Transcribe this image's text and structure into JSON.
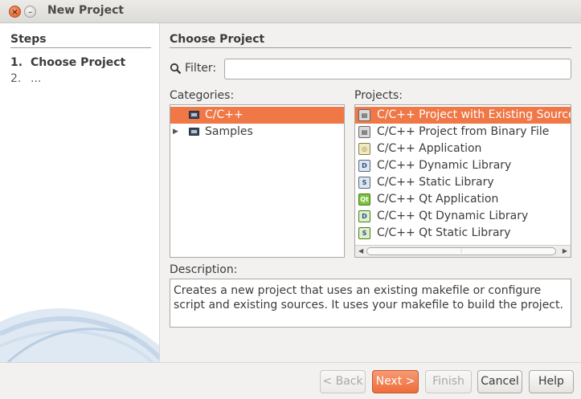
{
  "window": {
    "title": "New Project"
  },
  "steps": {
    "header": "Steps",
    "items": [
      {
        "num": "1.",
        "label": "Choose Project"
      },
      {
        "num": "2.",
        "label": "..."
      }
    ]
  },
  "main": {
    "header": "Choose Project",
    "filter_label": "Filter:",
    "filter_value": "",
    "categories_label": "Categories:",
    "projects_label": "Projects:",
    "description_label": "Description:"
  },
  "categories": [
    {
      "label": "C/C++",
      "selected": true,
      "expandable": false
    },
    {
      "label": "Samples",
      "selected": false,
      "expandable": true
    }
  ],
  "projects": [
    {
      "label": "C/C++ Project with Existing Sources",
      "icon": "project-existing-sources-icon",
      "selected": true
    },
    {
      "label": "C/C++ Project from Binary File",
      "icon": "project-binary-file-icon",
      "selected": false
    },
    {
      "label": "C/C++ Application",
      "icon": "application-icon",
      "selected": false
    },
    {
      "label": "C/C++ Dynamic Library",
      "icon": "dynamic-library-icon",
      "selected": false
    },
    {
      "label": "C/C++ Static Library",
      "icon": "static-library-icon",
      "selected": false
    },
    {
      "label": "C/C++ Qt Application",
      "icon": "qt-application-icon",
      "selected": false
    },
    {
      "label": "C/C++ Qt Dynamic Library",
      "icon": "qt-dynamic-library-icon",
      "selected": false
    },
    {
      "label": "C/C++ Qt Static Library",
      "icon": "qt-static-library-icon",
      "selected": false
    }
  ],
  "description": "Creates a new project that uses an existing makefile or configure script and existing sources. It uses your makefile to build the project.",
  "buttons": {
    "back": "< Back",
    "next": "Next >",
    "finish": "Finish",
    "cancel": "Cancel",
    "help": "Help"
  },
  "colors": {
    "accent": "#f07746",
    "panel": "#ffffff",
    "background": "#f2f1f0"
  }
}
